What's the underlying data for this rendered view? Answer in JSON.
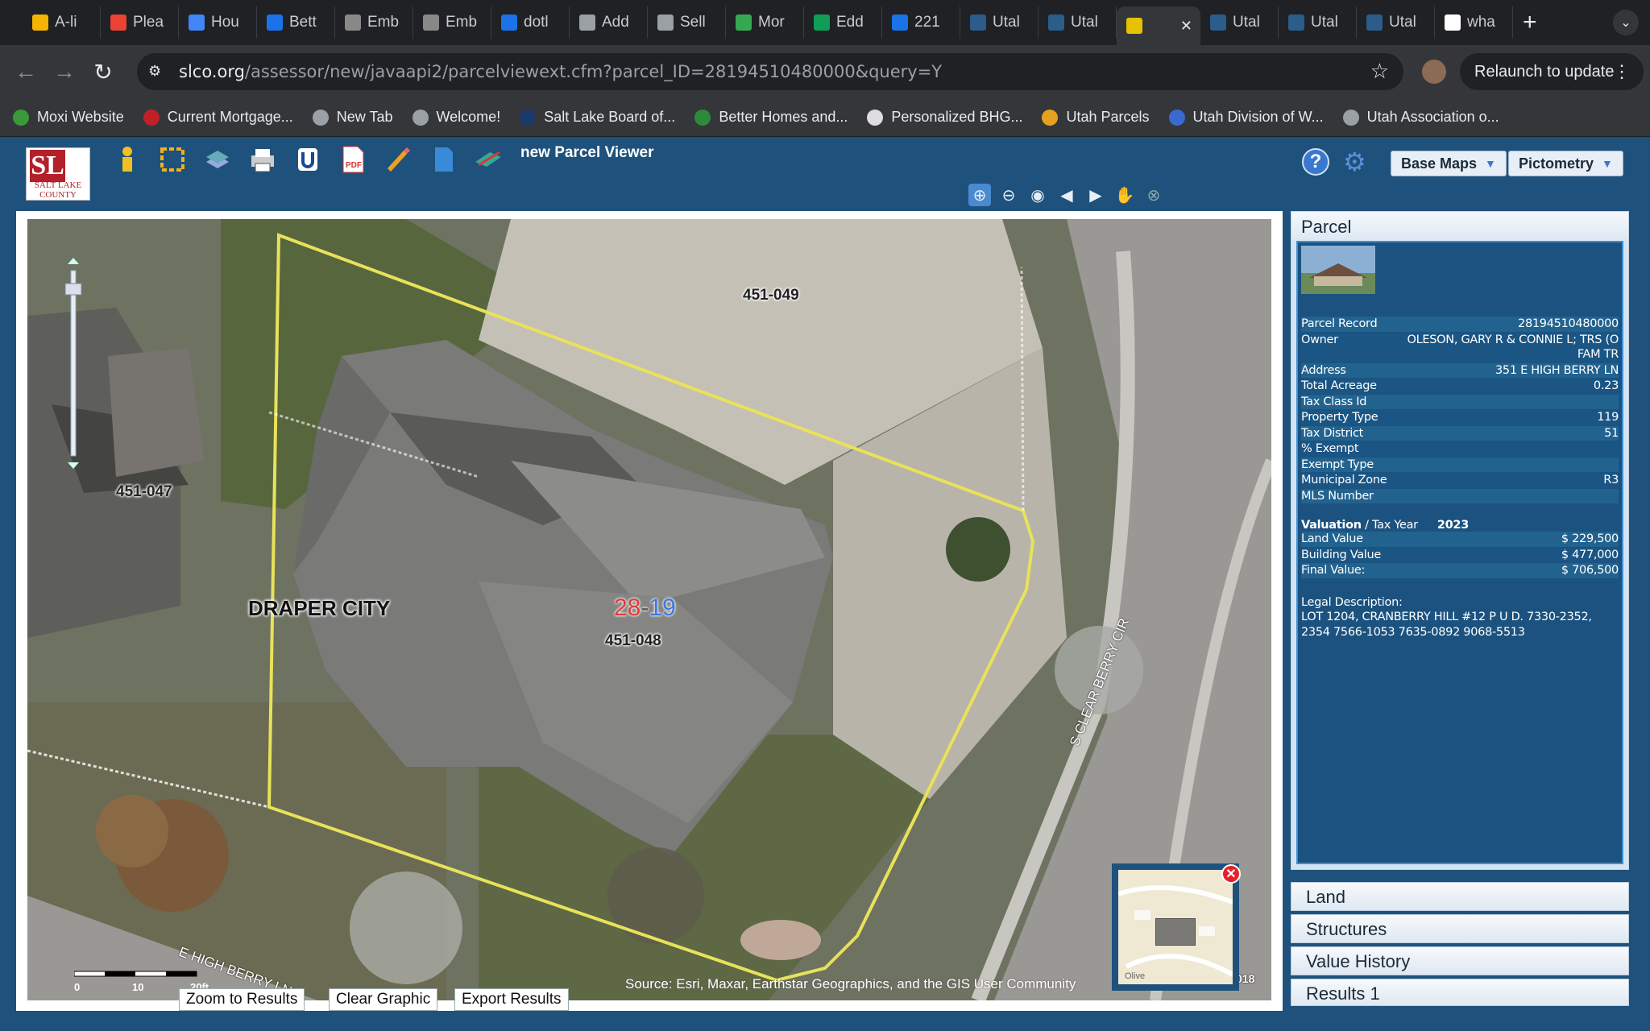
{
  "browser": {
    "tabs": [
      {
        "title": "A-li",
        "color": "#f4b400"
      },
      {
        "title": "Plea",
        "color": "#ea4335"
      },
      {
        "title": "Hou",
        "color": "#4285f4"
      },
      {
        "title": "Bett",
        "color": "#1a73e8"
      },
      {
        "title": "Emb",
        "color": "#888888"
      },
      {
        "title": "Emb",
        "color": "#888888"
      },
      {
        "title": "dotl",
        "color": "#1a73e8"
      },
      {
        "title": "Add",
        "color": "#9aa0a6"
      },
      {
        "title": "Sell",
        "color": "#9aa0a6"
      },
      {
        "title": "Mor",
        "color": "#34a853"
      },
      {
        "title": "Edd",
        "color": "#0f9d58"
      },
      {
        "title": "221",
        "color": "#1a73e8"
      },
      {
        "title": "Utal",
        "color": "#2b5c8a"
      },
      {
        "title": "Utal",
        "color": "#2b5c8a"
      },
      {
        "title": "",
        "color": "#e6c200",
        "active": true
      },
      {
        "title": "Utal",
        "color": "#2b5c8a"
      },
      {
        "title": "Utal",
        "color": "#2b5c8a"
      },
      {
        "title": "Utal",
        "color": "#2b5c8a"
      },
      {
        "title": "wha",
        "color": "#ffffff"
      }
    ],
    "url_domain": "slco.org",
    "url_path": "/assessor/new/javaapi2/parcelviewext.cfm?parcel_ID=28194510480000&query=Y",
    "relaunch_label": "Relaunch to update",
    "bookmarks": [
      {
        "label": "Moxi Website",
        "color": "#3a9a3a"
      },
      {
        "label": "Current Mortgage...",
        "color": "#c0202a"
      },
      {
        "label": "New Tab",
        "color": "#9aa0a6"
      },
      {
        "label": "Welcome!",
        "color": "#9aa0a6"
      },
      {
        "label": "Salt Lake Board of...",
        "color": "#1a3a6a"
      },
      {
        "label": "Better Homes and...",
        "color": "#2d8a3a"
      },
      {
        "label": "Personalized BHG...",
        "color": "#dddddd"
      },
      {
        "label": "Utah Parcels",
        "color": "#e6a020"
      },
      {
        "label": "Utah Division of W...",
        "color": "#3a6ad0"
      },
      {
        "label": "Utah Association o...",
        "color": "#9aa0a6"
      }
    ]
  },
  "app": {
    "logo_letters": "SL",
    "logo_text": "SALT LAKE COUNTY",
    "title": "new Parcel Viewer",
    "help_label": "?",
    "base_maps_label": "Base Maps",
    "pictometry_label": "Pictometry"
  },
  "map": {
    "labels": {
      "p049": "451-049",
      "p047": "451-047",
      "p048": "451-048",
      "city": "DRAPER CITY",
      "sec_a": "28",
      "sec_sep": "-",
      "sec_b": "19",
      "street1": "S CLEAR BERRY CIR",
      "street2": "E HIGH BERRY LN",
      "ov_label": "Olive",
      "edge_num": "018"
    },
    "scale": {
      "s0": "0",
      "s10": "10",
      "s20": "20ft"
    },
    "source": "Source: Esri, Maxar, Earthstar Geographics, and the GIS User Community",
    "buttons": {
      "zoom": "Zoom to Results",
      "clear": "Clear Graphic",
      "export": "Export Results"
    }
  },
  "parcel": {
    "header": "Parcel",
    "rows": [
      {
        "k": "Parcel Record",
        "v": "28194510480000"
      },
      {
        "k": "Owner",
        "v": "OLESON, GARY R & CONNIE L; TRS (O FAM TR"
      },
      {
        "k": "Address",
        "v": "351 E HIGH BERRY LN"
      },
      {
        "k": "Total Acreage",
        "v": "0.23"
      },
      {
        "k": "Tax Class Id",
        "v": ""
      },
      {
        "k": "Property Type",
        "v": "119"
      },
      {
        "k": "Tax District",
        "v": "51"
      },
      {
        "k": "% Exempt",
        "v": ""
      },
      {
        "k": "Exempt Type",
        "v": ""
      },
      {
        "k": "Municipal Zone",
        "v": "R3"
      },
      {
        "k": "MLS Number",
        "v": ""
      }
    ],
    "valuation_label": "Valuation",
    "tax_year_label": " / Tax Year",
    "tax_year": "2023",
    "values": [
      {
        "k": "Land Value",
        "v": "$ 229,500"
      },
      {
        "k": "Building Value",
        "v": "$ 477,000"
      },
      {
        "k": "Final Value:",
        "v": "$ 706,500"
      }
    ],
    "legal_label": "Legal Description:",
    "legal_text": "LOT 1204, CRANBERRY HILL #12 P U D. 7330-2352, 2354 7566-1053 7635-0892 9068-5513"
  },
  "accordion": [
    "Land",
    "Structures",
    "Value History",
    "Results 1"
  ]
}
